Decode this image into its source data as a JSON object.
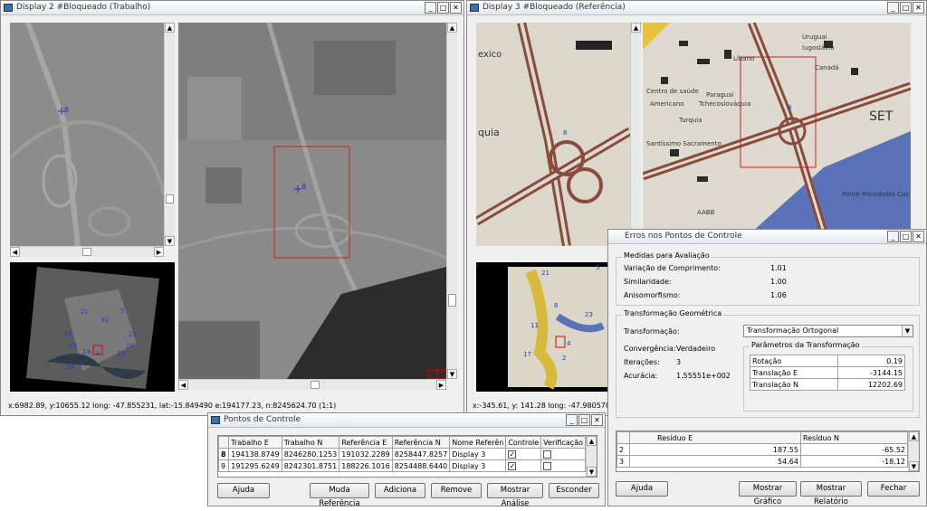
{
  "display2": {
    "title": "Display 2 #Bloqueado (Trabalho)",
    "status": "x:6982.89, y:10655.12 long: -47.855231, lat:-15.849490 e:194177.23, n:8245624.70 (1:1)",
    "point_label": "8"
  },
  "display3": {
    "title": "Display 3 #Bloqueado (Referência)",
    "status": "x:-345.61, y: 141.28 long: -47.980578, lat: -15.",
    "map_labels": [
      "Uruguai",
      "Iugoslávia",
      "Canadá",
      "Líbano",
      "Centro de saúde",
      "Americano",
      "Tchecoslováquia",
      "Paraguai",
      "Turquia",
      "Santíssimo Sacramento",
      "Ponte Presidente Cos",
      "SET",
      "AABB",
      "quia",
      "exico"
    ]
  },
  "control_points_window": {
    "title": "Pontos de Controle",
    "columns": [
      "",
      "Trabalho E",
      "Trabalho N",
      "Referência E",
      "Referência N",
      "Nome Referên",
      "Controle",
      "Verificação"
    ],
    "rows": [
      {
        "id": "8",
        "trab_e": "194138.8749",
        "trab_n": "8246280.1253",
        "ref_e": "191032.2289",
        "ref_n": "8258447.8257",
        "nome": "Display 3",
        "controle": "✓",
        "verificacao": ""
      },
      {
        "id": "9",
        "trab_e": "191295.6249",
        "trab_n": "8242301.8751",
        "ref_e": "188226.1016",
        "ref_n": "8254488.6440",
        "nome": "Display 3",
        "controle": "✓",
        "verificacao": ""
      }
    ],
    "buttons": {
      "ajuda": "Ajuda",
      "muda": "Muda Referência",
      "adiciona": "Adiciona",
      "remove": "Remove",
      "mostrar": "Mostrar Análise",
      "esconder": "Esconder"
    }
  },
  "errors_window": {
    "title": "Erros nos Pontos de Controle",
    "medidas": {
      "group_label": "Medidas para Avaliação",
      "variacao_label": "Variação de Comprimento:",
      "variacao_value": "1.01",
      "similaridade_label": "Similaridade:",
      "similaridade_value": "1.00",
      "anisomorfismo_label": "Anisomorfismo:",
      "anisomorfismo_value": "1.06"
    },
    "transformacao": {
      "group_label": "Transformação Geométrica",
      "tipo_label": "Transformação:",
      "tipo_value": "Transformação Ortogonal",
      "convergencia_label": "Convergência:",
      "convergencia_value": "Verdadeiro",
      "iteracoes_label": "Iterações:",
      "iteracoes_value": "3",
      "acuracia_label": "Acurácia:",
      "acuracia_value": "1.55551e+002",
      "params_label": "Parâmetros da Transformação",
      "params": [
        {
          "name": "Rotação",
          "value": "0.19"
        },
        {
          "name": "Translação E",
          "value": "-3144.15"
        },
        {
          "name": "Translação N",
          "value": "12202.69"
        }
      ]
    },
    "residuos": {
      "columns": [
        "",
        "Resíduo E",
        "Resíduo N"
      ],
      "rows": [
        {
          "id": "2",
          "e": "187.55",
          "n": "-65.52"
        },
        {
          "id": "3",
          "e": "54.64",
          "n": "-18.12"
        }
      ]
    },
    "buttons": {
      "ajuda": "Ajuda",
      "grafico": "Mostrar Gráfico",
      "relatorio": "Mostrar Relatório",
      "fechar": "Fechar"
    }
  },
  "overview_points_left": [
    "21",
    "30",
    "5",
    "18",
    "13",
    "23",
    "14",
    "24",
    "4",
    "12",
    "18"
  ],
  "overview_points_right": [
    "21",
    "5",
    "8",
    "23",
    "11",
    "4",
    "17",
    "2"
  ],
  "window_controls": {
    "min": "_",
    "max": "□",
    "close": "✕"
  }
}
